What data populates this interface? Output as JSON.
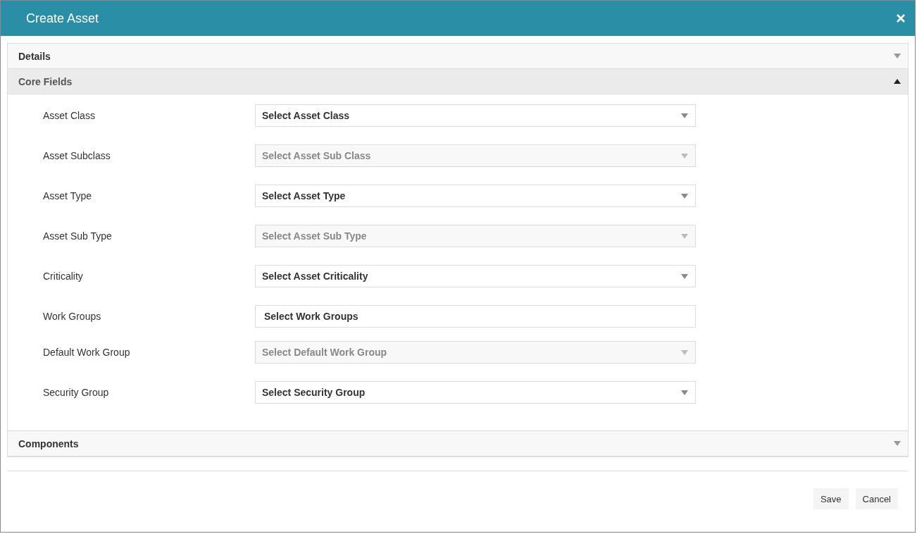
{
  "dialog": {
    "title": "Create Asset"
  },
  "sections": [
    {
      "title": "Details",
      "expanded": false
    },
    {
      "title": "Core Fields",
      "expanded": true,
      "fields": [
        {
          "label": "Asset Class",
          "kind": "select",
          "placeholder": "Select Asset Class",
          "disabled": false
        },
        {
          "label": "Asset Subclass",
          "kind": "select",
          "placeholder": "Select Asset Sub Class",
          "disabled": true
        },
        {
          "label": "Asset Type",
          "kind": "select",
          "placeholder": "Select Asset Type",
          "disabled": false
        },
        {
          "label": "Asset Sub Type",
          "kind": "select",
          "placeholder": "Select Asset Sub Type",
          "disabled": true
        },
        {
          "label": "Criticality",
          "kind": "select",
          "placeholder": "Select Asset Criticality",
          "disabled": false
        },
        {
          "label": "Work Groups",
          "kind": "multiselect",
          "placeholder": "Select Work Groups",
          "disabled": false
        },
        {
          "label": "Default Work Group",
          "kind": "select",
          "placeholder": "Select Default Work Group",
          "disabled": true
        },
        {
          "label": "Security Group",
          "kind": "select",
          "placeholder": "Select Security Group",
          "disabled": false
        }
      ]
    },
    {
      "title": "Components",
      "expanded": false
    }
  ],
  "buttons": [
    "Save",
    "Cancel"
  ]
}
